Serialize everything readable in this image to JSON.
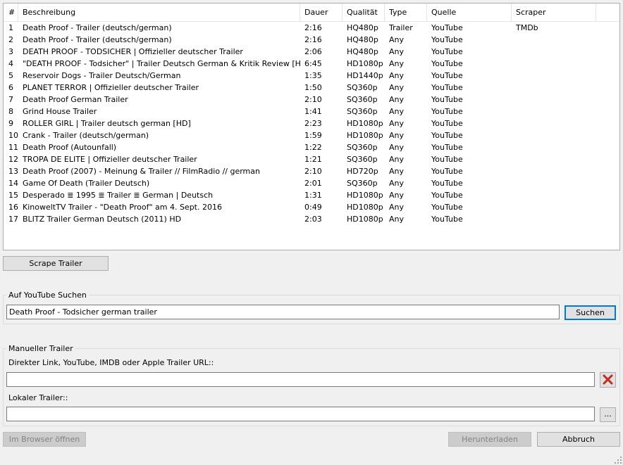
{
  "table": {
    "columns": [
      "#",
      "Beschreibung",
      "Dauer",
      "Qualität",
      "Type",
      "Quelle",
      "Scraper"
    ],
    "rows": [
      {
        "num": "1",
        "desc": "Death Proof - Trailer (deutsch/german)",
        "dur": "2:16",
        "qual": "HQ480p",
        "type": "Trailer",
        "src": "YouTube",
        "scraper": "TMDb"
      },
      {
        "num": "2",
        "desc": "Death Proof - Trailer (deutsch/german)",
        "dur": "2:16",
        "qual": "HQ480p",
        "type": "Any",
        "src": "YouTube",
        "scraper": ""
      },
      {
        "num": "3",
        "desc": "DEATH PROOF - TODSICHER | Offizieller deutscher Trailer",
        "dur": "2:06",
        "qual": "HQ480p",
        "type": "Any",
        "src": "YouTube",
        "scraper": ""
      },
      {
        "num": "4",
        "desc": "\"DEATH PROOF - Todsicher\" | Trailer Deutsch German & Kritik Review [HD]",
        "dur": "6:45",
        "qual": "HD1080p",
        "type": "Any",
        "src": "YouTube",
        "scraper": ""
      },
      {
        "num": "5",
        "desc": "Reservoir Dogs - Trailer Deutsch/German",
        "dur": "1:35",
        "qual": "HD1440p",
        "type": "Any",
        "src": "YouTube",
        "scraper": ""
      },
      {
        "num": "6",
        "desc": "PLANET TERROR |  Offizieller deutscher Trailer",
        "dur": "1:50",
        "qual": "SQ360p",
        "type": "Any",
        "src": "YouTube",
        "scraper": ""
      },
      {
        "num": "7",
        "desc": "Death Proof German Trailer",
        "dur": "2:10",
        "qual": "SQ360p",
        "type": "Any",
        "src": "YouTube",
        "scraper": ""
      },
      {
        "num": "8",
        "desc": "Grind House Trailer",
        "dur": "1:41",
        "qual": "SQ360p",
        "type": "Any",
        "src": "YouTube",
        "scraper": ""
      },
      {
        "num": "9",
        "desc": "ROLLER GIRL | Trailer deutsch german [HD]",
        "dur": "2:23",
        "qual": "HD1080p",
        "type": "Any",
        "src": "YouTube",
        "scraper": ""
      },
      {
        "num": "10",
        "desc": "Crank - Trailer (deutsch/german)",
        "dur": "1:59",
        "qual": "HD1080p",
        "type": "Any",
        "src": "YouTube",
        "scraper": ""
      },
      {
        "num": "11",
        "desc": "Death Proof (Autounfall)",
        "dur": "1:22",
        "qual": "SQ360p",
        "type": "Any",
        "src": "YouTube",
        "scraper": ""
      },
      {
        "num": "12",
        "desc": "TROPA DE ELITE | Offizieller deutscher Trailer",
        "dur": "1:21",
        "qual": "SQ360p",
        "type": "Any",
        "src": "YouTube",
        "scraper": ""
      },
      {
        "num": "13",
        "desc": "Death Proof (2007) - Meinung & Trailer // FilmRadio // german",
        "dur": "2:10",
        "qual": "HD720p",
        "type": "Any",
        "src": "YouTube",
        "scraper": ""
      },
      {
        "num": "14",
        "desc": "Game Of Death (Trailer Deutsch)",
        "dur": "2:01",
        "qual": "SQ360p",
        "type": "Any",
        "src": "YouTube",
        "scraper": ""
      },
      {
        "num": "15",
        "desc": "Desperado ≣ 1995 ≣ Trailer ≣ German | Deutsch",
        "dur": "1:31",
        "qual": "HD1080p",
        "type": "Any",
        "src": "YouTube",
        "scraper": ""
      },
      {
        "num": "16",
        "desc": "KinoweltTV Trailer - \"Death Proof\" am 4. Sept. 2016",
        "dur": "0:49",
        "qual": "HD1080p",
        "type": "Any",
        "src": "YouTube",
        "scraper": ""
      },
      {
        "num": "17",
        "desc": "BLITZ Trailer German Deutsch (2011) HD",
        "dur": "2:03",
        "qual": "HD1080p",
        "type": "Any",
        "src": "YouTube",
        "scraper": ""
      }
    ]
  },
  "scrape_button": "Scrape Trailer",
  "youtube_search": {
    "group_label": "Auf YouTube Suchen",
    "query": "Death Proof - Todsicher german trailer",
    "search_button": "Suchen"
  },
  "manual": {
    "group_label": "Manueller Trailer",
    "link_label": "Direkter Link, YouTube, IMDB oder Apple Trailer URL::",
    "link_value": "",
    "local_label": "Lokaler Trailer::",
    "local_value": "",
    "browse_button": "...",
    "clear_icon": "red-x-icon"
  },
  "footer": {
    "open_browser": "Im Browser öffnen",
    "download": "Herunterladen",
    "cancel": "Abbruch"
  },
  "colors": {
    "accent": "#0078d7",
    "clear_red": "#c42b1c"
  }
}
